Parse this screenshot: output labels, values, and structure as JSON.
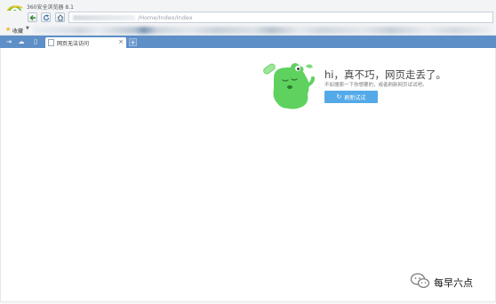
{
  "window": {
    "app_title": "360安全浏览器 8.1"
  },
  "toolbar": {
    "url_text": "/Home/Index/Index"
  },
  "favorites": {
    "label": "收藏"
  },
  "tabs": [
    {
      "label": "网页无法访问",
      "active": true
    }
  ],
  "error_page": {
    "title": "hi，真不巧，网页走丢了。",
    "subtitle": "不如搜索一下你想要的，或者刷新网页试试吧。",
    "retry_label": "刷新试试"
  },
  "watermark": {
    "text": "每早六点"
  },
  "colors": {
    "tab_bar": "#5e8fc7",
    "retry_button": "#54a9e8",
    "mascot_green": "#5fd15f",
    "logo_green": "#3fae2a"
  }
}
